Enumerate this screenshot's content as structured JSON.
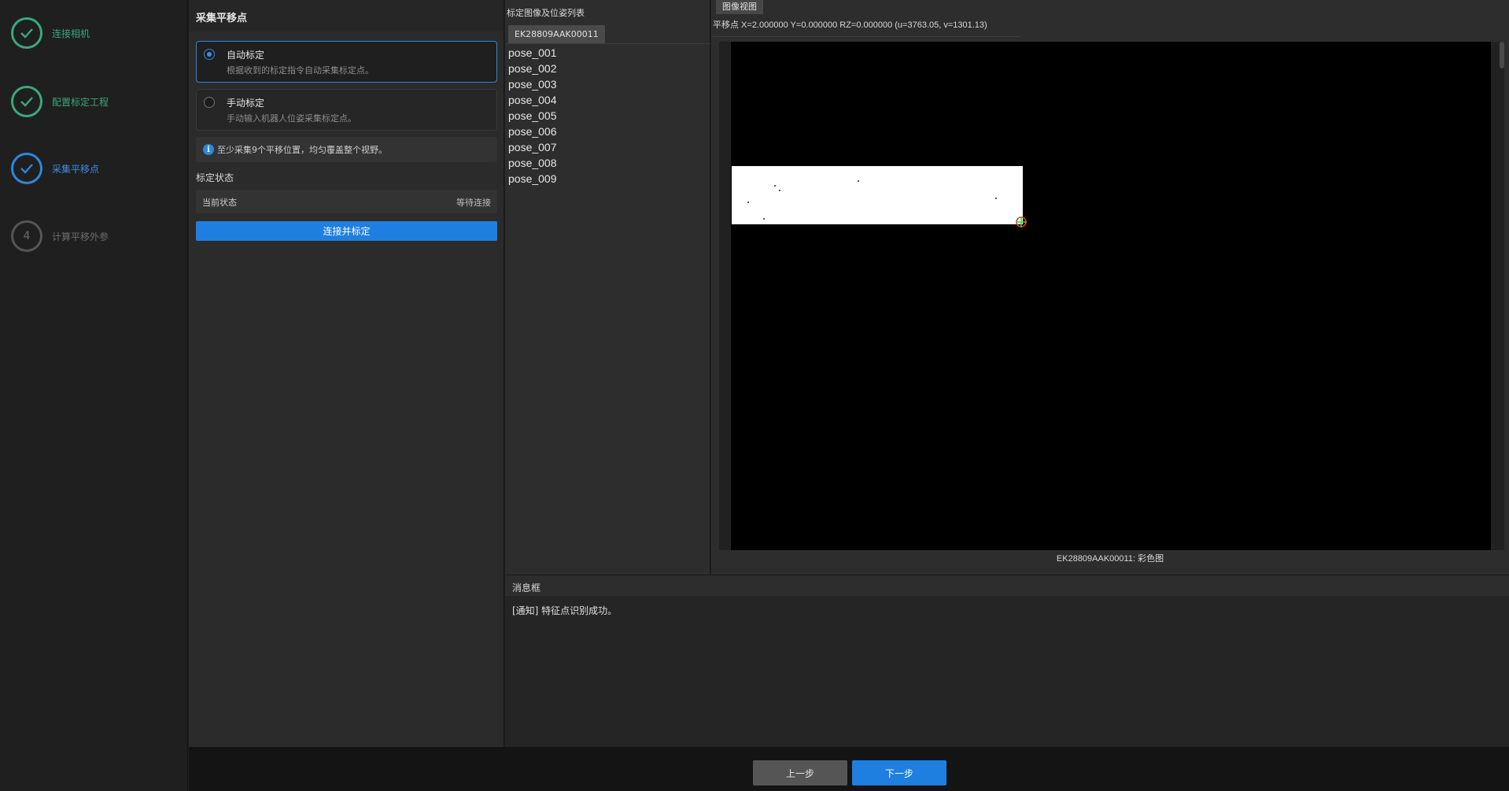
{
  "steps": [
    {
      "label": "连接相机",
      "state": "done",
      "icon": "check-icon"
    },
    {
      "label": "配置标定工程",
      "state": "done",
      "icon": "check-icon"
    },
    {
      "label": "采集平移点",
      "state": "active",
      "icon": "check-icon"
    },
    {
      "label": "计算平移外参",
      "state": "pending",
      "number": "4"
    }
  ],
  "left_panel": {
    "title": "采集平移点",
    "modes": [
      {
        "title": "自动标定",
        "desc": "根据收到的标定指令自动采集标定点。",
        "selected": true
      },
      {
        "title": "手动标定",
        "desc": "手动输入机器人位姿采集标定点。",
        "selected": false
      }
    ],
    "info_icon": "i",
    "info_text": "至少采集9个平移位置，均匀覆盖整个视野。",
    "status_heading": "标定状态",
    "status_label": "当前状态",
    "status_value": "等待连接",
    "connect_button": "连接并标定"
  },
  "pose_panel": {
    "title": "标定图像及位姿列表",
    "camera_tab": "EK28809AAK00011",
    "poses": [
      "pose_001",
      "pose_002",
      "pose_003",
      "pose_004",
      "pose_005",
      "pose_006",
      "pose_007",
      "pose_008",
      "pose_009"
    ]
  },
  "image_view": {
    "tab": "图像视图",
    "readout": "平移点  X=2.000000  Y=0.000000  RZ=0.000000  (u=3763.05, v=1301.13)",
    "caption": "EK28809AAK00011: 彩色图"
  },
  "message_box": {
    "title": "消息框",
    "messages": [
      "[通知] 特征点识别成功。"
    ]
  },
  "footer": {
    "prev_label": "上一步",
    "next_label": "下一步"
  },
  "colors": {
    "done": "#3aa87b",
    "active": "#2f86db",
    "primary_button": "#1e7fe0"
  }
}
